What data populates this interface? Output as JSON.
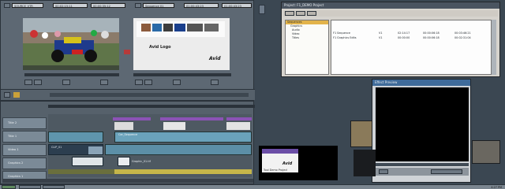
{
  "source_monitor": {
    "clip_name": "SOURCE_VTR",
    "timecode_in": "00:02:15:11",
    "timecode_out": "00:00:35:12"
  },
  "record_monitor": {
    "sequence_name": "Sequence 01",
    "timecode": "01:00:43:23",
    "card_title": "Avid Logo",
    "card_sub": "Avid"
  },
  "timeline": {
    "tracks": [
      "Title 2",
      "Title 1",
      "Video 1",
      "Graphics 2",
      "Graphics 1"
    ],
    "clip_labels": [
      "CLIP_01",
      "Graphic_01.tif",
      "Logo_Title_01",
      "Car_Sequence"
    ]
  },
  "project_window": {
    "title": "Project: F1_DEMO Project",
    "folders": [
      "Sequences",
      "Graphics",
      "Audio",
      "Video",
      "Titles"
    ],
    "bins": [
      {
        "name": "F1 Sequence",
        "c1": "V1",
        "c2": "02:14:17",
        "c3": "00:00:06:18",
        "c4": "00:03:46:21"
      },
      {
        "name": "F1 Graphics Edits",
        "c1": "V1",
        "c2": "00:00:00",
        "c3": "00:00:06:18",
        "c4": "00:02:31:04"
      }
    ]
  },
  "effect_window": {
    "title": "Effect Preview"
  },
  "thumb_card": {
    "line1": "Avid",
    "line2": "Tool Demo Project"
  },
  "taskbar": {
    "time": "4:27 PM"
  }
}
